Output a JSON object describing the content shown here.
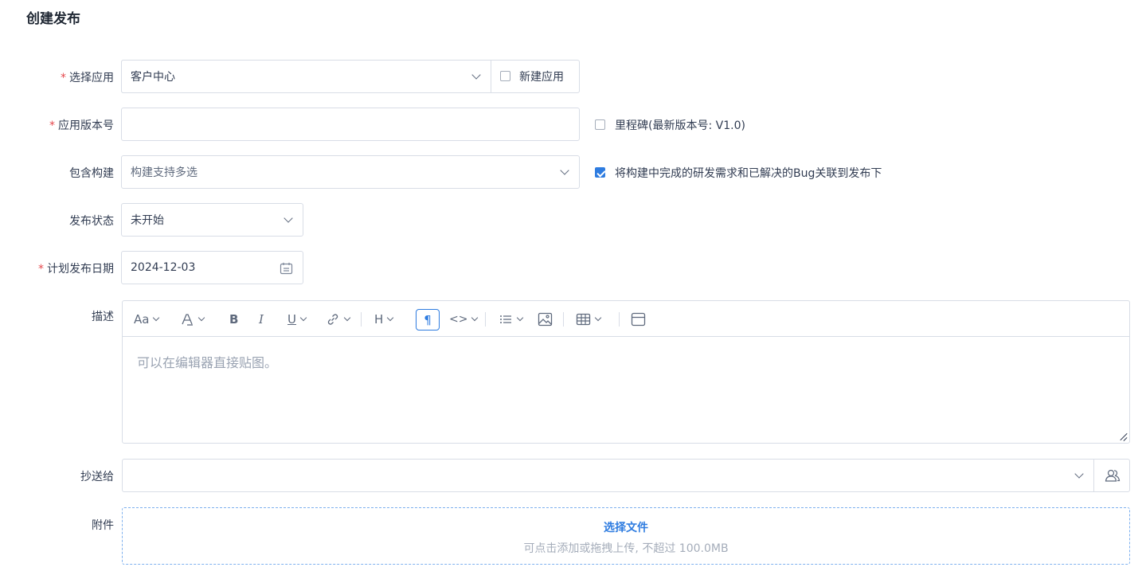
{
  "page": {
    "title": "创建发布"
  },
  "form": {
    "app": {
      "label": "选择应用",
      "required_mark": "*",
      "value": "客户中心",
      "new_app_label": "新建应用",
      "new_app_checked": false
    },
    "version": {
      "label": "应用版本号",
      "required_mark": "*",
      "value": "",
      "milestone_label": "里程碑(最新版本号: V1.0)",
      "milestone_checked": false
    },
    "builds": {
      "label": "包含构建",
      "placeholder": "构建支持多选",
      "link_label": "将构建中完成的研发需求和已解决的Bug关联到发布下",
      "link_checked": true
    },
    "status": {
      "label": "发布状态",
      "value": "未开始"
    },
    "date": {
      "label": "计划发布日期",
      "required_mark": "*",
      "value": "2024-12-03"
    },
    "description": {
      "label": "描述",
      "placeholder": "可以在编辑器直接贴图。",
      "toolbar": {
        "font_size": "Aa",
        "bold": "B",
        "italic": "I",
        "underline": "U",
        "heading": "H",
        "paragraph": "¶",
        "code": "<>"
      }
    },
    "cc": {
      "label": "抄送给",
      "value": ""
    },
    "attachment": {
      "label": "附件",
      "select_label": "选择文件",
      "hint": "可点击添加或拖拽上传, 不超过 100.0MB"
    }
  },
  "colors": {
    "accent": "#2e7ce0",
    "required": "#e5484d",
    "border": "#d8dde6"
  }
}
